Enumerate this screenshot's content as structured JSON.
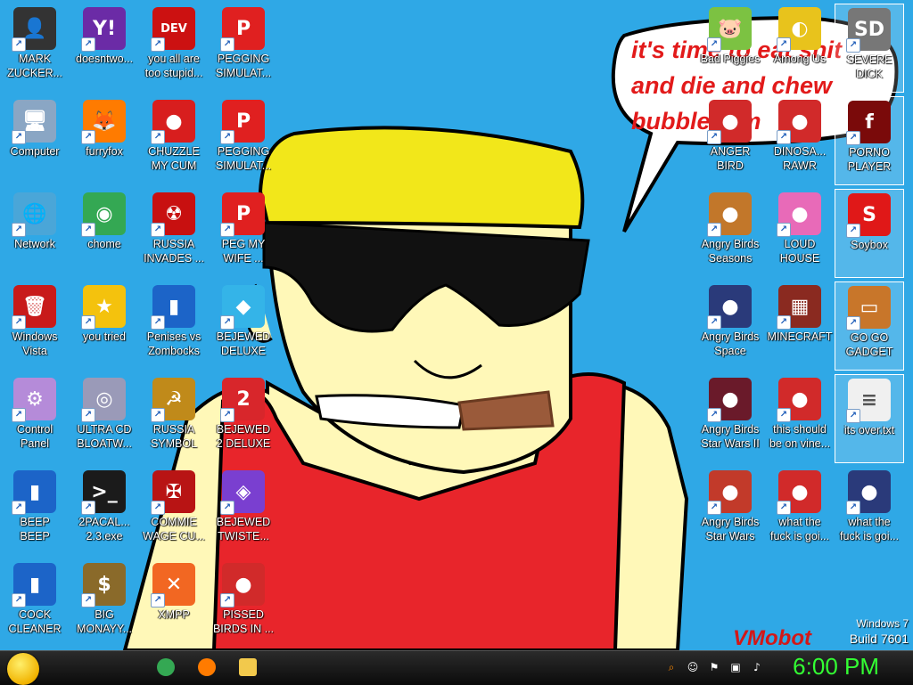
{
  "desktop": {
    "icons_left": [
      {
        "label": "MARK\nZUCKER...",
        "icon": "person-icon",
        "color": "#333333"
      },
      {
        "label": "doesntwo...",
        "icon": "yahoo-messenger-icon",
        "color": "#6b2ba6"
      },
      {
        "label": "you all are\ntoo stupid...",
        "icon": "dev-cpp-icon",
        "color": "#cc1111"
      },
      {
        "label": "PEGGING\nSIMULAT...",
        "icon": "pegging-p-icon",
        "color": "#e02020"
      },
      {
        "label": "Computer",
        "icon": "computer-icon",
        "color": "#8aa6c4"
      },
      {
        "label": "furryfox",
        "icon": "firefox-icon",
        "color": "#ff7b00"
      },
      {
        "label": "CHUZZLE\nMY CUM",
        "icon": "chuzzle-icon",
        "color": "#d81e1e"
      },
      {
        "label": "PEGGING\nSIMULAT...",
        "icon": "pegging-p-icon",
        "color": "#e02020"
      },
      {
        "label": "Network",
        "icon": "network-icon",
        "color": "#4aa6d8"
      },
      {
        "label": "chome",
        "icon": "chrome-icon",
        "color": "#34a853"
      },
      {
        "label": "RUSSIA\nINVADES ...",
        "icon": "radiation-icon",
        "color": "#c81010"
      },
      {
        "label": "PEG MY\nWIFE ...",
        "icon": "pegging-p-icon",
        "color": "#e02020"
      },
      {
        "label": "Windows\nVista",
        "icon": "recycle-bin-icon",
        "color": "#c81a1a"
      },
      {
        "label": "you tried",
        "icon": "gold-star-icon",
        "color": "#f4c20d"
      },
      {
        "label": "Penises vs\nZombocks",
        "icon": "blue-book-icon",
        "color": "#1c64c8"
      },
      {
        "label": "BEJEWED\nDELUXE",
        "icon": "diamond-icon",
        "color": "#34b4e8"
      },
      {
        "label": "Control\nPanel",
        "icon": "control-panel-icon",
        "color": "#b58bd9"
      },
      {
        "label": "ULTRA CD\nBLOATW...",
        "icon": "cd-icon",
        "color": "#9a9ab8"
      },
      {
        "label": "RUSSIA\nSYMBOL",
        "icon": "gold-symbol-icon",
        "color": "#c08a1a"
      },
      {
        "label": "BEJEWED\n2 DELUXE",
        "icon": "bejeweled-2-icon",
        "color": "#d8262b"
      },
      {
        "label": "BEEP\nBEEP",
        "icon": "blue-book-icon",
        "color": "#1c64c8"
      },
      {
        "label": "2PACAL...\n2.3.exe",
        "icon": "console-icon",
        "color": "#1b1b1b"
      },
      {
        "label": "COMMIE\nWAGE CU...",
        "icon": "eagle-emblem-icon",
        "color": "#b81414"
      },
      {
        "label": "BEJEWED\nTWISTE...",
        "icon": "twisted-gem-icon",
        "color": "#7a3fd0"
      },
      {
        "label": "COCK\nCLEANER",
        "icon": "blue-book-icon",
        "color": "#1c64c8"
      },
      {
        "label": "BIG\nMONAYY...",
        "icon": "money-bag-icon",
        "color": "#8a6a2a"
      },
      {
        "label": "XMPP",
        "icon": "xampp-icon",
        "color": "#f26722"
      },
      {
        "label": "PISSED\nBIRDS IN ...",
        "icon": "angry-bird-icon",
        "color": "#d12a2a"
      }
    ],
    "icons_right": [
      {
        "label": "Bad Piggies",
        "icon": "bad-piggies-icon",
        "color": "#7cc242",
        "sel": false
      },
      {
        "label": "Among Us",
        "icon": "among-us-icon",
        "color": "#e8c31c",
        "sel": false
      },
      {
        "label": "SEVERE\nDICK",
        "icon": "sd-card-icon",
        "color": "#777777",
        "sel": true
      },
      {
        "label": "ANGER\nBIRD",
        "icon": "angry-bird-icon",
        "color": "#d12a2a",
        "sel": false
      },
      {
        "label": "DINOSA...\nRAWR",
        "icon": "angry-bird-icon",
        "color": "#d12a2a",
        "sel": false
      },
      {
        "label": "PORNO\nPLAYER",
        "icon": "flash-icon",
        "color": "#7a0a0a",
        "sel": true
      },
      {
        "label": "Angry Birds\nSeasons",
        "icon": "angry-birds-seasons-icon",
        "color": "#c2772a",
        "sel": false
      },
      {
        "label": "LOUD\nHOUSE",
        "icon": "pink-bird-icon",
        "color": "#e86ab8",
        "sel": false
      },
      {
        "label": "Soybox",
        "icon": "soybox-icon",
        "color": "#e01818",
        "sel": true
      },
      {
        "label": "Angry Birds\nSpace",
        "icon": "angry-birds-space-icon",
        "color": "#2a3a7a",
        "sel": false
      },
      {
        "label": "MINECRAFT",
        "icon": "minecraft-icon",
        "color": "#8a2a20",
        "sel": false
      },
      {
        "label": "GO GO\nGADGET",
        "icon": "briefcase-icon",
        "color": "#c8762a",
        "sel": true
      },
      {
        "label": "Angry Birds\nStar Wars II",
        "icon": "angry-birds-star-wars-icon",
        "color": "#6a1a2a",
        "sel": false
      },
      {
        "label": "this should\nbe on vine...",
        "icon": "angry-bird-icon",
        "color": "#d12a2a",
        "sel": false
      },
      {
        "label": "its over.txt",
        "icon": "text-file-icon",
        "color": "#f0f0f0",
        "sel": true
      },
      {
        "label": "Angry Birds\nStar Wars",
        "icon": "angry-birds-star-wars-icon",
        "color": "#c23a2a",
        "sel": false
      },
      {
        "label": "what the\nfuck is goi...",
        "icon": "angry-bird-icon",
        "color": "#d12a2a",
        "sel": false
      },
      {
        "label": "what the\nfuck is goi...",
        "icon": "angry-birds-space-icon",
        "color": "#2a3a7a",
        "sel": false
      }
    ]
  },
  "wallpaper": {
    "speech_bubble": "it's time to eat shit\nand die and chew\nbubblegum",
    "signature": "VMobot"
  },
  "watermark": {
    "line1": "Windows 7",
    "line2": "Build 7601"
  },
  "taskbar": {
    "pinned": [
      {
        "icon": "chrome-icon",
        "color": "#34a853"
      },
      {
        "icon": "firefox-icon",
        "color": "#ff7b00"
      },
      {
        "icon": "folder-icon",
        "color": "#f2c94c"
      }
    ],
    "tray": [
      "search-icon",
      "messenger-icon",
      "flag-icon",
      "network-tray-icon",
      "volume-icon"
    ],
    "clock": "6:00 PM"
  }
}
